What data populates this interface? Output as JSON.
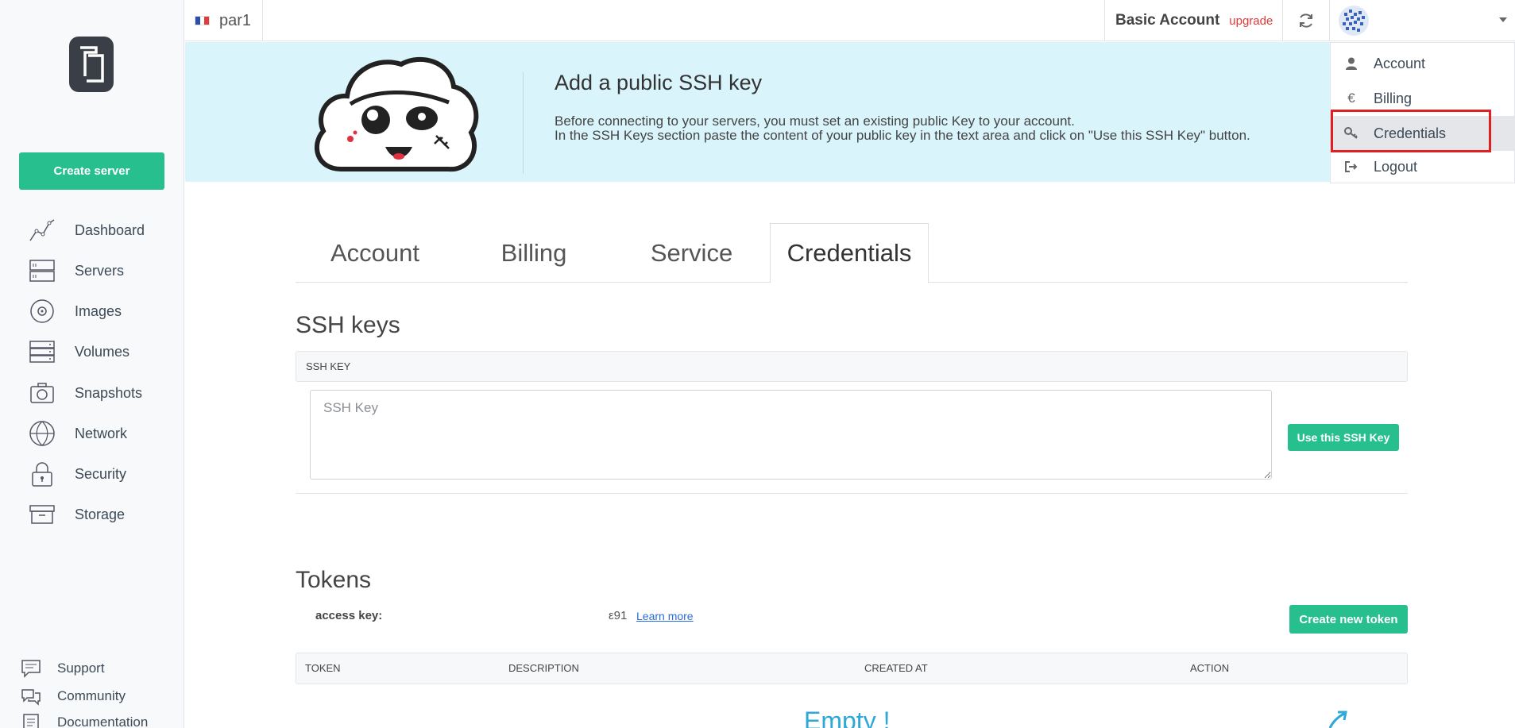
{
  "sidebar": {
    "create_server_label": "Create server",
    "items": [
      {
        "label": "Dashboard",
        "icon": "dashboard-icon"
      },
      {
        "label": "Servers",
        "icon": "servers-icon"
      },
      {
        "label": "Images",
        "icon": "images-icon"
      },
      {
        "label": "Volumes",
        "icon": "volumes-icon"
      },
      {
        "label": "Snapshots",
        "icon": "snapshots-icon"
      },
      {
        "label": "Network",
        "icon": "network-icon"
      },
      {
        "label": "Security",
        "icon": "security-icon"
      },
      {
        "label": "Storage",
        "icon": "storage-icon"
      }
    ],
    "footer": [
      {
        "label": "Support",
        "icon": "support-icon"
      },
      {
        "label": "Community",
        "icon": "community-icon"
      },
      {
        "label": "Documentation",
        "icon": "documentation-icon"
      }
    ]
  },
  "topbar": {
    "region": "par1",
    "account_type": "Basic Account",
    "upgrade_label": "upgrade"
  },
  "dropdown": {
    "items": [
      {
        "label": "Account",
        "icon": "user-icon"
      },
      {
        "label": "Billing",
        "icon": "euro-icon"
      },
      {
        "label": "Credentials",
        "icon": "key-icon"
      },
      {
        "label": "Logout",
        "icon": "logout-icon"
      }
    ],
    "active": "Credentials"
  },
  "banner": {
    "title": "Add a public SSH key",
    "line1": "Before connecting to your servers, you must set an existing public Key to your account.",
    "line2": "In the SSH Keys section paste the content of your public key in the text area and click on \"Use this SSH Key\" button."
  },
  "tabs": [
    {
      "label": "Account"
    },
    {
      "label": "Billing"
    },
    {
      "label": "Service"
    },
    {
      "label": "Credentials"
    }
  ],
  "active_tab": "Credentials",
  "ssh": {
    "title": "SSH keys",
    "header": "SSH KEY",
    "placeholder": "SSH Key",
    "button_label": "Use this SSH Key"
  },
  "tokens": {
    "title": "Tokens",
    "access_key_label": "access key:",
    "access_key_value": "ε91",
    "learn_more": "Learn more",
    "create_label": "Create new token",
    "columns": [
      "TOKEN",
      "DESCRIPTION",
      "CREATED AT",
      "ACTION"
    ],
    "empty_text": "Empty !"
  },
  "colors": {
    "accent": "#27bf8e",
    "banner_bg": "#d9f4fb",
    "upgrade": "#e53935",
    "highlight": "#e02020",
    "empty": "#2ea8d8"
  }
}
